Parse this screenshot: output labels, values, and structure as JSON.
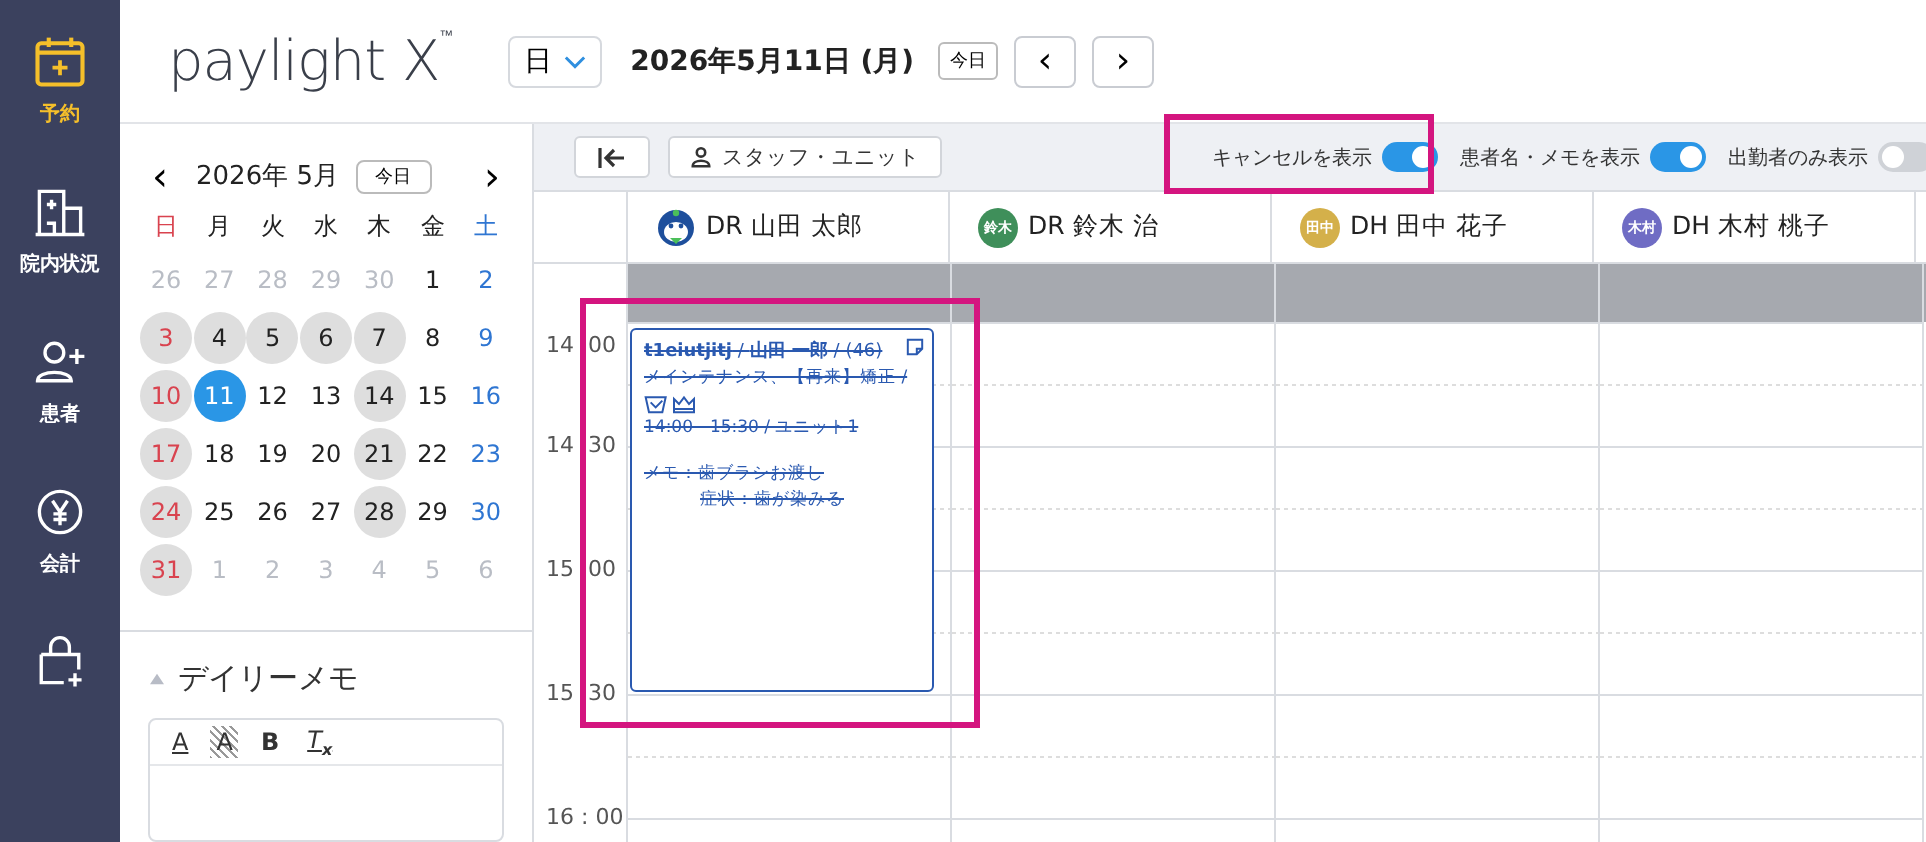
{
  "nav": [
    {
      "label": "予約",
      "selected": true
    },
    {
      "label": "院内状況",
      "selected": false
    },
    {
      "label": "患者",
      "selected": false
    },
    {
      "label": "会計",
      "selected": false
    },
    {
      "selected": false
    }
  ],
  "logo": {
    "text": "paylight X",
    "mark": "™"
  },
  "header": {
    "view": "日",
    "date": "2026年5月11日 (月)",
    "today": "今日",
    "prev": "‹",
    "next": "›"
  },
  "mini_calendar": {
    "month": "2026年 5月",
    "today": "今日",
    "prev": "‹",
    "next": "›",
    "weekdays": [
      "日",
      "月",
      "火",
      "水",
      "木",
      "金",
      "土"
    ],
    "weeks": [
      [
        {
          "label": "26",
          "other_month": true,
          "marked": false,
          "selected": false
        },
        {
          "label": "27",
          "other_month": true,
          "marked": false,
          "selected": false
        },
        {
          "label": "28",
          "other_month": true,
          "marked": false,
          "selected": false
        },
        {
          "label": "29",
          "other_month": true,
          "marked": false,
          "selected": false
        },
        {
          "label": "30",
          "other_month": true,
          "marked": false,
          "selected": false
        },
        {
          "label": "1",
          "other_month": false,
          "marked": false,
          "selected": false
        },
        {
          "label": "2",
          "other_month": false,
          "marked": false,
          "selected": false
        }
      ],
      [
        {
          "label": "3",
          "other_month": false,
          "marked": true,
          "selected": false
        },
        {
          "label": "4",
          "other_month": false,
          "marked": true,
          "selected": false
        },
        {
          "label": "5",
          "other_month": false,
          "marked": true,
          "selected": false
        },
        {
          "label": "6",
          "other_month": false,
          "marked": true,
          "selected": false
        },
        {
          "label": "7",
          "other_month": false,
          "marked": true,
          "selected": false
        },
        {
          "label": "8",
          "other_month": false,
          "marked": false,
          "selected": false
        },
        {
          "label": "9",
          "other_month": false,
          "marked": false,
          "selected": false
        }
      ],
      [
        {
          "label": "10",
          "other_month": false,
          "marked": true,
          "selected": false
        },
        {
          "label": "11",
          "other_month": false,
          "marked": false,
          "selected": true
        },
        {
          "label": "12",
          "other_month": false,
          "marked": false,
          "selected": false
        },
        {
          "label": "13",
          "other_month": false,
          "marked": false,
          "selected": false
        },
        {
          "label": "14",
          "other_month": false,
          "marked": true,
          "selected": false
        },
        {
          "label": "15",
          "other_month": false,
          "marked": false,
          "selected": false
        },
        {
          "label": "16",
          "other_month": false,
          "marked": false,
          "selected": false
        }
      ],
      [
        {
          "label": "17",
          "other_month": false,
          "marked": true,
          "selected": false
        },
        {
          "label": "18",
          "other_month": false,
          "marked": false,
          "selected": false
        },
        {
          "label": "19",
          "other_month": false,
          "marked": false,
          "selected": false
        },
        {
          "label": "20",
          "other_month": false,
          "marked": false,
          "selected": false
        },
        {
          "label": "21",
          "other_month": false,
          "marked": true,
          "selected": false
        },
        {
          "label": "22",
          "other_month": false,
          "marked": false,
          "selected": false
        },
        {
          "label": "23",
          "other_month": false,
          "marked": false,
          "selected": false
        }
      ],
      [
        {
          "label": "24",
          "other_month": false,
          "marked": true,
          "selected": false
        },
        {
          "label": "25",
          "other_month": false,
          "marked": false,
          "selected": false
        },
        {
          "label": "26",
          "other_month": false,
          "marked": false,
          "selected": false
        },
        {
          "label": "27",
          "other_month": false,
          "marked": false,
          "selected": false
        },
        {
          "label": "28",
          "other_month": false,
          "marked": true,
          "selected": false
        },
        {
          "label": "29",
          "other_month": false,
          "marked": false,
          "selected": false
        },
        {
          "label": "30",
          "other_month": false,
          "marked": false,
          "selected": false
        }
      ],
      [
        {
          "label": "31",
          "other_month": false,
          "marked": true,
          "selected": false
        },
        {
          "label": "1",
          "other_month": true,
          "marked": false,
          "selected": false
        },
        {
          "label": "2",
          "other_month": true,
          "marked": false,
          "selected": false
        },
        {
          "label": "3",
          "other_month": true,
          "marked": false,
          "selected": false
        },
        {
          "label": "4",
          "other_month": true,
          "marked": false,
          "selected": false
        },
        {
          "label": "5",
          "other_month": true,
          "marked": false,
          "selected": false
        },
        {
          "label": "6",
          "other_month": true,
          "marked": false,
          "selected": false
        }
      ]
    ]
  },
  "daily_memo": {
    "title": "デイリーメモ",
    "expanded": true,
    "tools": [
      {
        "kind": "color",
        "label": "A"
      },
      {
        "kind": "highlight",
        "label": "A"
      },
      {
        "kind": "bold",
        "label": "B"
      },
      {
        "kind": "clear",
        "label": "T",
        "sub": "x"
      }
    ]
  },
  "toolbar": {
    "staff_unit": "スタッフ・ユニット",
    "toggles": [
      {
        "label": "キャンセルを表示",
        "on": true
      },
      {
        "label": "患者名・メモを表示",
        "on": true
      },
      {
        "label": "出勤者のみ表示",
        "on": false
      }
    ]
  },
  "staff": [
    {
      "name": "DR 山田 太郎"
    },
    {
      "name": "DR 鈴木 治",
      "avatar": "鈴木",
      "color": "#3f8f5a"
    },
    {
      "name": "DH 田中 花子",
      "avatar": "田中",
      "color": "#d4b04a"
    },
    {
      "name": "DH 木村 桃子",
      "avatar": "木村",
      "color": "#6f6cc4"
    }
  ],
  "times": [
    {
      "hour": "14",
      "minute": "00"
    },
    {
      "hour": "14",
      "minute": "30"
    },
    {
      "hour": "15",
      "minute": "00"
    },
    {
      "hour": "15",
      "minute": "30"
    },
    {
      "label": "16 : 00"
    }
  ],
  "appointment": {
    "canceled": true,
    "title": "**t1eiutjitj** / **山田 一郎** / (46)",
    "treatment": "メインテナンス、【再来】矯正 /",
    "time": "14:00 - 15:30 / ユニット1",
    "memo": "メモ：歯ブラシお渡し",
    "symptom": "症状：歯が染みる"
  }
}
